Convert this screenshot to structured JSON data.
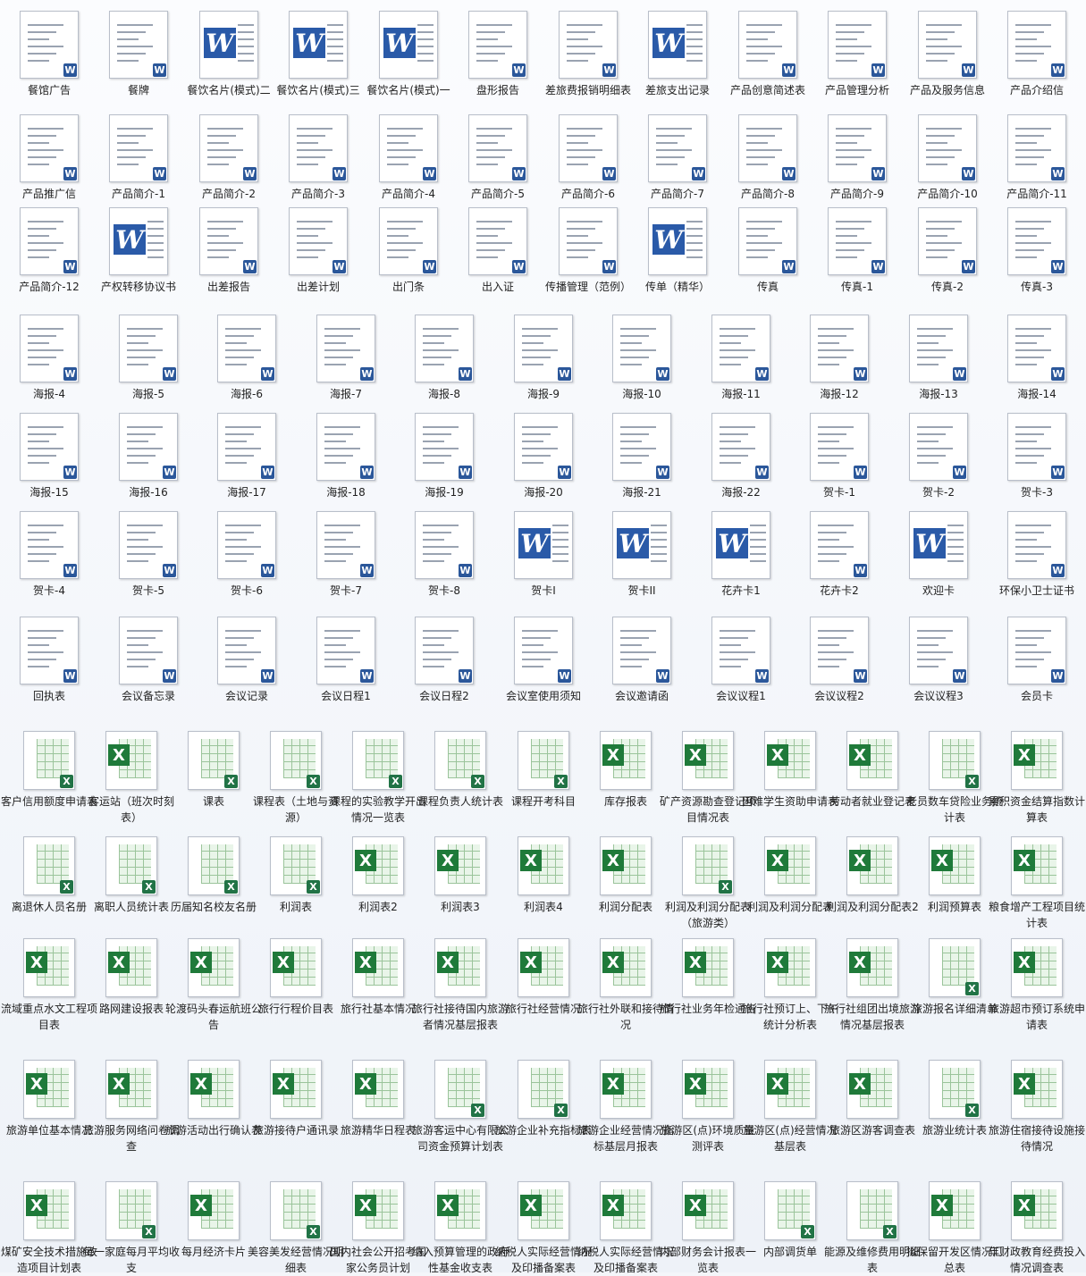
{
  "rows": [
    [
      [
        "餐馆广告",
        "w"
      ],
      [
        "餐牌",
        "w"
      ],
      [
        "餐饮名片(模式)二",
        "W"
      ],
      [
        "餐饮名片(模式)三",
        "W"
      ],
      [
        "餐饮名片(模式)一",
        "W"
      ],
      [
        "盘形报告",
        "w"
      ],
      [
        "差旅费报销明细表",
        "w"
      ],
      [
        "差旅支出记录",
        "W"
      ],
      [
        "产品创意简述表",
        "w"
      ],
      [
        "产品管理分析",
        "w"
      ],
      [
        "产品及服务信息",
        "w"
      ],
      [
        "产品介绍信",
        "w"
      ]
    ],
    [
      [
        "产品推广信",
        "w"
      ],
      [
        "产品简介-1",
        "w"
      ],
      [
        "产品简介-2",
        "w"
      ],
      [
        "产品简介-3",
        "w"
      ],
      [
        "产品简介-4",
        "w"
      ],
      [
        "产品简介-5",
        "w"
      ],
      [
        "产品简介-6",
        "w"
      ],
      [
        "产品简介-7",
        "w"
      ],
      [
        "产品简介-8",
        "w"
      ],
      [
        "产品简介-9",
        "w"
      ],
      [
        "产品简介-10",
        "w"
      ],
      [
        "产品简介-11",
        "w"
      ]
    ],
    [
      [
        "产品简介-12",
        "w"
      ],
      [
        "产权转移协议书",
        "W"
      ],
      [
        "出差报告",
        "w"
      ],
      [
        "出差计划",
        "w"
      ],
      [
        "出门条",
        "w"
      ],
      [
        "出入证",
        "w"
      ],
      [
        "传播管理（范例）",
        "w"
      ],
      [
        "传单（精华）",
        "W"
      ],
      [
        "传真",
        "w"
      ],
      [
        "传真-1",
        "w"
      ],
      [
        "传真-2",
        "w"
      ],
      [
        "传真-3",
        "w"
      ]
    ],
    [
      [
        "海报-4",
        "w"
      ],
      [
        "海报-5",
        "w"
      ],
      [
        "海报-6",
        "w"
      ],
      [
        "海报-7",
        "w"
      ],
      [
        "海报-8",
        "w"
      ],
      [
        "海报-9",
        "w"
      ],
      [
        "海报-10",
        "w"
      ],
      [
        "海报-11",
        "w"
      ],
      [
        "海报-12",
        "w"
      ],
      [
        "海报-13",
        "w"
      ],
      [
        "海报-14",
        "w"
      ]
    ],
    [
      [
        "海报-15",
        "w"
      ],
      [
        "海报-16",
        "w"
      ],
      [
        "海报-17",
        "w"
      ],
      [
        "海报-18",
        "w"
      ],
      [
        "海报-19",
        "w"
      ],
      [
        "海报-20",
        "w"
      ],
      [
        "海报-21",
        "w"
      ],
      [
        "海报-22",
        "w"
      ],
      [
        "贺卡-1",
        "w"
      ],
      [
        "贺卡-2",
        "w"
      ],
      [
        "贺卡-3",
        "w"
      ]
    ],
    [
      [
        "贺卡-4",
        "w"
      ],
      [
        "贺卡-5",
        "w"
      ],
      [
        "贺卡-6",
        "w"
      ],
      [
        "贺卡-7",
        "w"
      ],
      [
        "贺卡-8",
        "w"
      ],
      [
        "贺卡I",
        "W"
      ],
      [
        "贺卡II",
        "W"
      ],
      [
        "花卉卡1",
        "W"
      ],
      [
        "花卉卡2",
        "w"
      ],
      [
        "欢迎卡",
        "W"
      ],
      [
        "环保小卫士证书",
        "w"
      ]
    ],
    [
      [
        "回执表",
        "w"
      ],
      [
        "会议备忘录",
        "w"
      ],
      [
        "会议记录",
        "w"
      ],
      [
        "会议日程1",
        "w"
      ],
      [
        "会议日程2",
        "w"
      ],
      [
        "会议室使用须知",
        "w"
      ],
      [
        "会议邀请函",
        "w"
      ],
      [
        "会议议程1",
        "w"
      ],
      [
        "会议议程2",
        "w"
      ],
      [
        "会议议程3",
        "w"
      ],
      [
        "会员卡",
        "w"
      ]
    ],
    [
      [
        "客户信用额度申请表",
        "x"
      ],
      [
        "客运站（班次时刻表）",
        "X"
      ],
      [
        "课表",
        "x"
      ],
      [
        "课程表（土地与资源）",
        "x"
      ],
      [
        "课程的实验教学开出情况一览表",
        "x"
      ],
      [
        "课程负责人统计表",
        "x"
      ],
      [
        "课程开考科目",
        "x"
      ],
      [
        "库存报表",
        "X"
      ],
      [
        "矿产资源勘查登记项目情况表",
        "X"
      ],
      [
        "困难学生资助申请表",
        "X"
      ],
      [
        "劳动者就业登记表",
        "X"
      ],
      [
        "老员数车贷险业务统计表",
        "x"
      ],
      [
        "累积资金结算指数计算表",
        "X"
      ]
    ],
    [
      [
        "离退休人员名册",
        "x"
      ],
      [
        "离职人员统计表",
        "x"
      ],
      [
        "历届知名校友名册",
        "x"
      ],
      [
        "利润表",
        "x"
      ],
      [
        "利润表2",
        "X"
      ],
      [
        "利润表3",
        "X"
      ],
      [
        "利润表4",
        "X"
      ],
      [
        "利润分配表",
        "X"
      ],
      [
        "利润及利润分配表（旅游类）",
        "x"
      ],
      [
        "利润及利润分配表",
        "X"
      ],
      [
        "利润及利润分配表2",
        "X"
      ],
      [
        "利润预算表",
        "X"
      ],
      [
        "粮食增产工程项目统计表",
        "X"
      ]
    ],
    [
      [
        "流域重点水文工程项目表",
        "X"
      ],
      [
        "路网建设报表",
        "X"
      ],
      [
        "轮渡码头春运航班公告",
        "X"
      ],
      [
        "旅行行程价目表",
        "X"
      ],
      [
        "旅行社基本情况",
        "X"
      ],
      [
        "旅行社接待国内旅游者情况基层报表",
        "X"
      ],
      [
        "旅行社经营情况",
        "X"
      ],
      [
        "旅行社外联和接待情况",
        "X"
      ],
      [
        "旅行社业务年检通告",
        "X"
      ],
      [
        "旅行社预订上、下午统计分析表",
        "X"
      ],
      [
        "旅行社组团出境旅游情况基层报表",
        "X"
      ],
      [
        "旅游报名详细清单",
        "x"
      ],
      [
        "旅游超市预订系统申请表",
        "X"
      ]
    ],
    [
      [
        "旅游单位基本情况",
        "X"
      ],
      [
        "旅游服务网络问卷调查",
        "X"
      ],
      [
        "旅游活动出行确认表",
        "X"
      ],
      [
        "旅游接待户通讯录",
        "X"
      ],
      [
        "旅游精华日程表",
        "X"
      ],
      [
        "旅游客运中心有限公司资金预算计划表",
        "x"
      ],
      [
        "旅游企业补充指标表",
        "x"
      ],
      [
        "旅游企业经营情况指标基层月报表",
        "X"
      ],
      [
        "旅游区(点)环境质量测评表",
        "X"
      ],
      [
        "旅游区(点)经营情况基层表",
        "X"
      ],
      [
        "旅游区游客调查表",
        "X"
      ],
      [
        "旅游业统计表",
        "x"
      ],
      [
        "旅游住宿接待设施接待情况",
        "X"
      ]
    ],
    [
      [
        "煤矿安全技术措施改造项目计划表",
        "X"
      ],
      [
        "每一家庭每月平均收支",
        "x"
      ],
      [
        "每月经济卡片",
        "X"
      ],
      [
        "美容美发经营情况明细表",
        "x"
      ],
      [
        "国内社会公开招考国家公务员计划",
        "X"
      ],
      [
        "纳入预算管理的政府性基金收支表",
        "X"
      ],
      [
        "纳税人实际经营情况及印播备案表",
        "X"
      ],
      [
        "纳税人实际经营情况及印播备案表",
        "X"
      ],
      [
        "内部财务会计报表一览表",
        "X"
      ],
      [
        "内部调货单",
        "x"
      ],
      [
        "能源及维修费用明细表",
        "x"
      ],
      [
        "拟保留开发区情况汇总表",
        "X"
      ],
      [
        "年财政教育经费投入情况调查表",
        "X"
      ]
    ]
  ]
}
